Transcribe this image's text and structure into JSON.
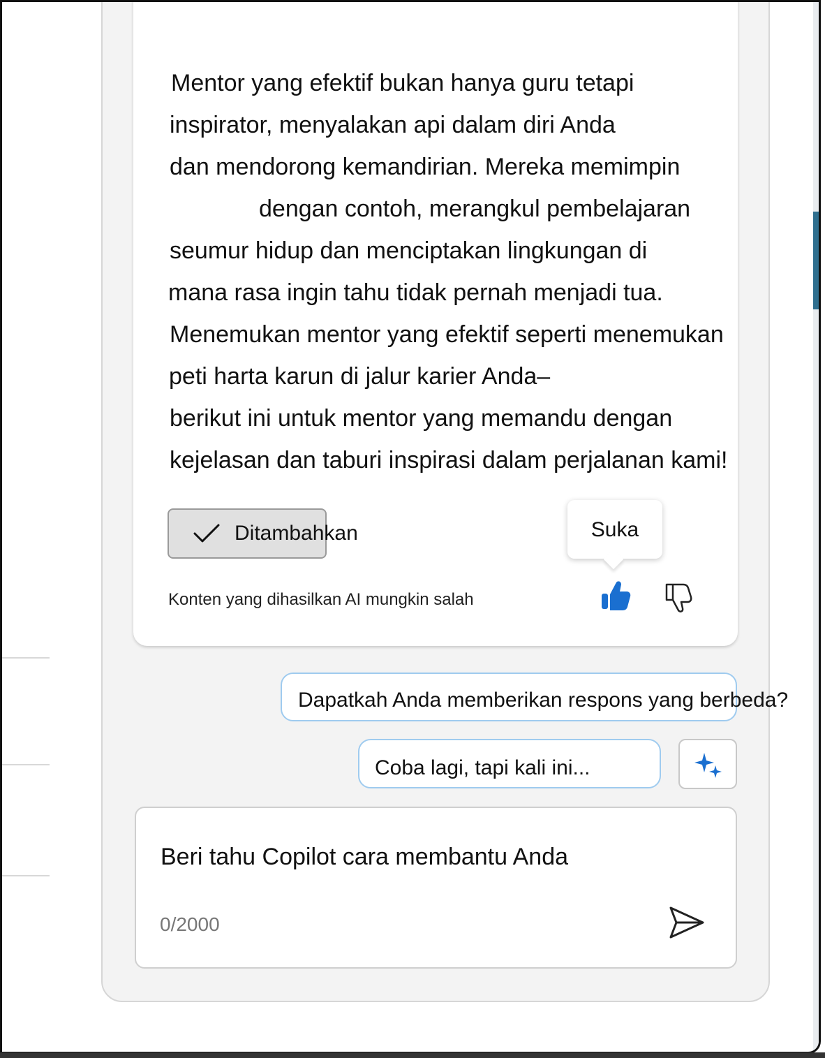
{
  "response": {
    "lines": [
      "Mentor yang efektif bukan hanya guru tetapi",
      "inspirator, menyalakan api dalam diri Anda",
      "dan mendorong kemandirian. Mereka memimpin",
      "dengan contoh, merangkul pembelajaran",
      "seumur hidup dan menciptakan lingkungan di",
      "mana rasa ingin tahu tidak pernah menjadi tua.",
      "Menemukan mentor yang efektif seperti menemukan",
      "peti harta karun di jalur karier Anda–",
      "berikut ini untuk mentor yang memandu dengan",
      "kejelasan dan taburi inspirasi dalam perjalanan kami!"
    ]
  },
  "actions": {
    "added_label": "Ditambahkan",
    "like_tooltip": "Suka",
    "disclaimer": "Konten yang dihasilkan AI mungkin salah"
  },
  "suggestions": {
    "different_response": "Dapatkah Anda memberikan respons yang berbeda?",
    "try_again": "Coba lagi, tapi kali ini..."
  },
  "composer": {
    "placeholder": "Beri tahu Copilot cara membantu Anda",
    "counter": "0/2000"
  },
  "colors": {
    "accent_blue": "#1a6fd0",
    "pill_border": "#9fcbef",
    "panel_bg": "#f3f3f3"
  },
  "icons": {
    "added": "checkmark-icon",
    "like": "thumbs-up-filled-icon",
    "dislike": "thumbs-down-icon",
    "sparkle": "sparkle-icon",
    "send": "send-icon"
  }
}
